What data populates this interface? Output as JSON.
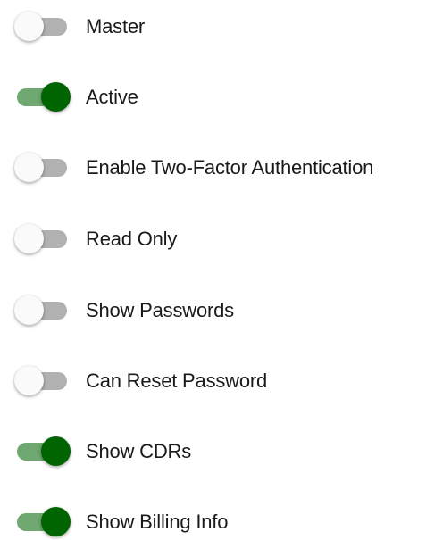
{
  "toggles": [
    {
      "label": "Master",
      "checked": false
    },
    {
      "label": "Active",
      "checked": true
    },
    {
      "label": "Enable Two-Factor Authentication",
      "checked": false
    },
    {
      "label": "Read Only",
      "checked": false
    },
    {
      "label": "Show Passwords",
      "checked": false
    },
    {
      "label": "Can Reset Password",
      "checked": false
    },
    {
      "label": "Show CDRs",
      "checked": true
    },
    {
      "label": "Show Billing Info",
      "checked": true
    }
  ],
  "colors": {
    "on_thumb": "#006400",
    "on_track": "#6fa870",
    "off_thumb": "#fafafa",
    "off_track": "#b1b1b1",
    "text": "#1a1a1a"
  }
}
